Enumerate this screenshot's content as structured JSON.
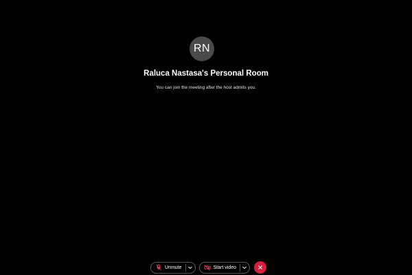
{
  "room": {
    "avatar_initials": "RN",
    "title": "Raluca Nastasa's Personal Room",
    "status_message": "You can join the meeting after the host admits you."
  },
  "controls": {
    "unmute_label": "Unmute",
    "start_video_label": "Start video"
  },
  "colors": {
    "background": "#000000",
    "avatar_bg": "#4a4a4a",
    "leave_red": "#d4213d",
    "muted_icon_red": "#e8485f"
  },
  "icons": {
    "unmute": "microphone-muted-icon",
    "start_video": "camera-off-icon",
    "leave": "close-icon"
  }
}
